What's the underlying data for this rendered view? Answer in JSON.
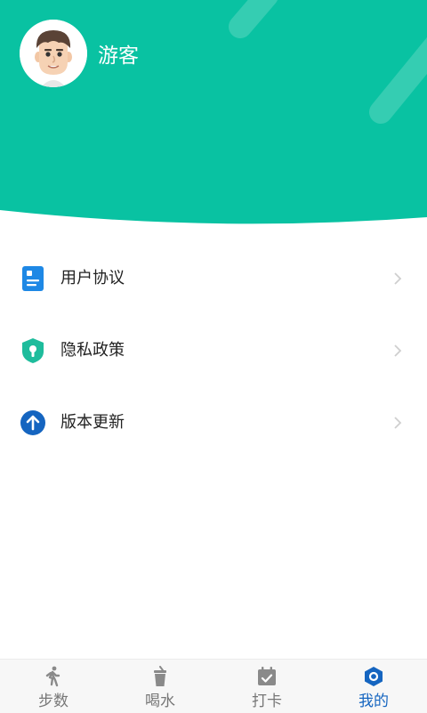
{
  "colors": {
    "header_bg": "#09c2a2",
    "accent": "#1565c0",
    "tab_inactive": "#777777"
  },
  "profile": {
    "name": "游客",
    "avatar_icon": "cartoon-man-avatar"
  },
  "menu": {
    "items": [
      {
        "label": "用户协议",
        "icon": "document-icon",
        "icon_color": "#1e88e5"
      },
      {
        "label": "隐私政策",
        "icon": "shield-lock-icon",
        "icon_color": "#1ebc9c"
      },
      {
        "label": "版本更新",
        "icon": "upload-arrow-icon",
        "icon_color": "#1565c0"
      }
    ]
  },
  "tabbar": {
    "tabs": [
      {
        "label": "步数",
        "icon": "walking-icon",
        "active": false
      },
      {
        "label": "喝水",
        "icon": "cup-icon",
        "active": false
      },
      {
        "label": "打卡",
        "icon": "calendar-check-icon",
        "active": false
      },
      {
        "label": "我的",
        "icon": "hexagon-profile-icon",
        "active": true
      }
    ]
  }
}
